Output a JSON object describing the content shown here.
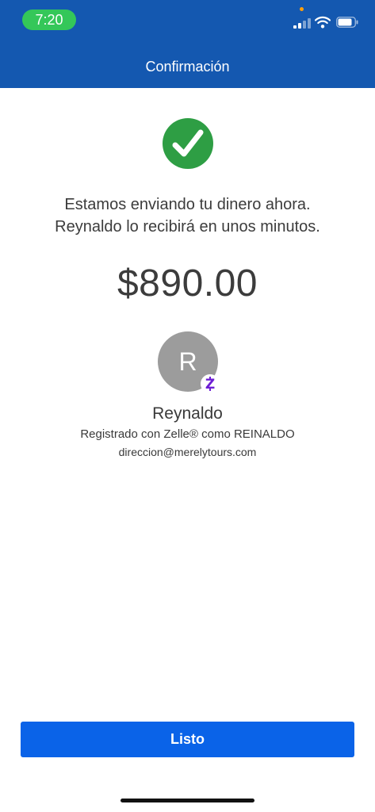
{
  "status_bar": {
    "time": "7:20",
    "icons": [
      "signal-icon",
      "wifi-icon",
      "battery-icon"
    ],
    "accent_colors": {
      "time_pill": "#34c759",
      "privacy_dot": "#ff9f0a"
    }
  },
  "header": {
    "title": "Confirmación",
    "background": "#1458b0"
  },
  "confirmation": {
    "icon": "check-circle-icon",
    "icon_color": "#2e9e44",
    "message_line1": "Estamos enviando tu dinero ahora.",
    "message_line2": "Reynaldo lo recibirá en unos minutos.",
    "amount": "$890.00"
  },
  "recipient": {
    "avatar_initial": "R",
    "badge_icon": "zelle-icon",
    "badge_color": "#6d1ed4",
    "name": "Reynaldo",
    "registered_text": "Registrado con Zelle® como REINALDO",
    "email": "direccion@merelytours.com"
  },
  "actions": {
    "done_label": "Listo",
    "done_color": "#0a63e8"
  }
}
